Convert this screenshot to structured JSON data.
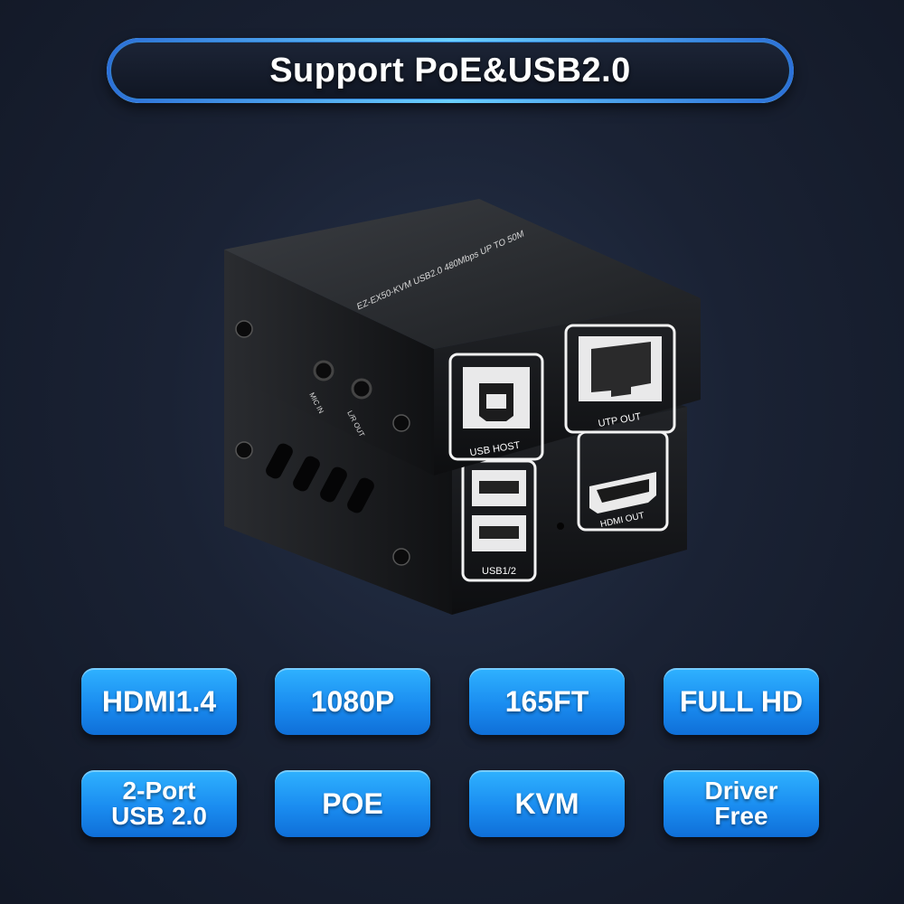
{
  "header": {
    "title": "Support PoE&USB2.0"
  },
  "device": {
    "model_text": "EZ-EX50-KVM   USB2.0 480Mbps UP TO 50M",
    "port_labels": {
      "usb_host": "USB HOST",
      "utp_out": "UTP OUT",
      "usb12": "USB1/2",
      "hdmi_out": "HDMI OUT",
      "mic_in": "MIC IN",
      "lr_out": "L/R OUT"
    }
  },
  "features": [
    {
      "line1": "HDMI1.4",
      "line2": ""
    },
    {
      "line1": "1080P",
      "line2": ""
    },
    {
      "line1": "165FT",
      "line2": ""
    },
    {
      "line1": "FULL HD",
      "line2": ""
    },
    {
      "line1": "2-Port",
      "line2": "USB 2.0"
    },
    {
      "line1": "POE",
      "line2": ""
    },
    {
      "line1": "KVM",
      "line2": ""
    },
    {
      "line1": "Driver",
      "line2": "Free"
    }
  ],
  "colors": {
    "background": "#1a2234",
    "badge": "#1a8cf0",
    "pill_border": "#7ed3f7"
  }
}
